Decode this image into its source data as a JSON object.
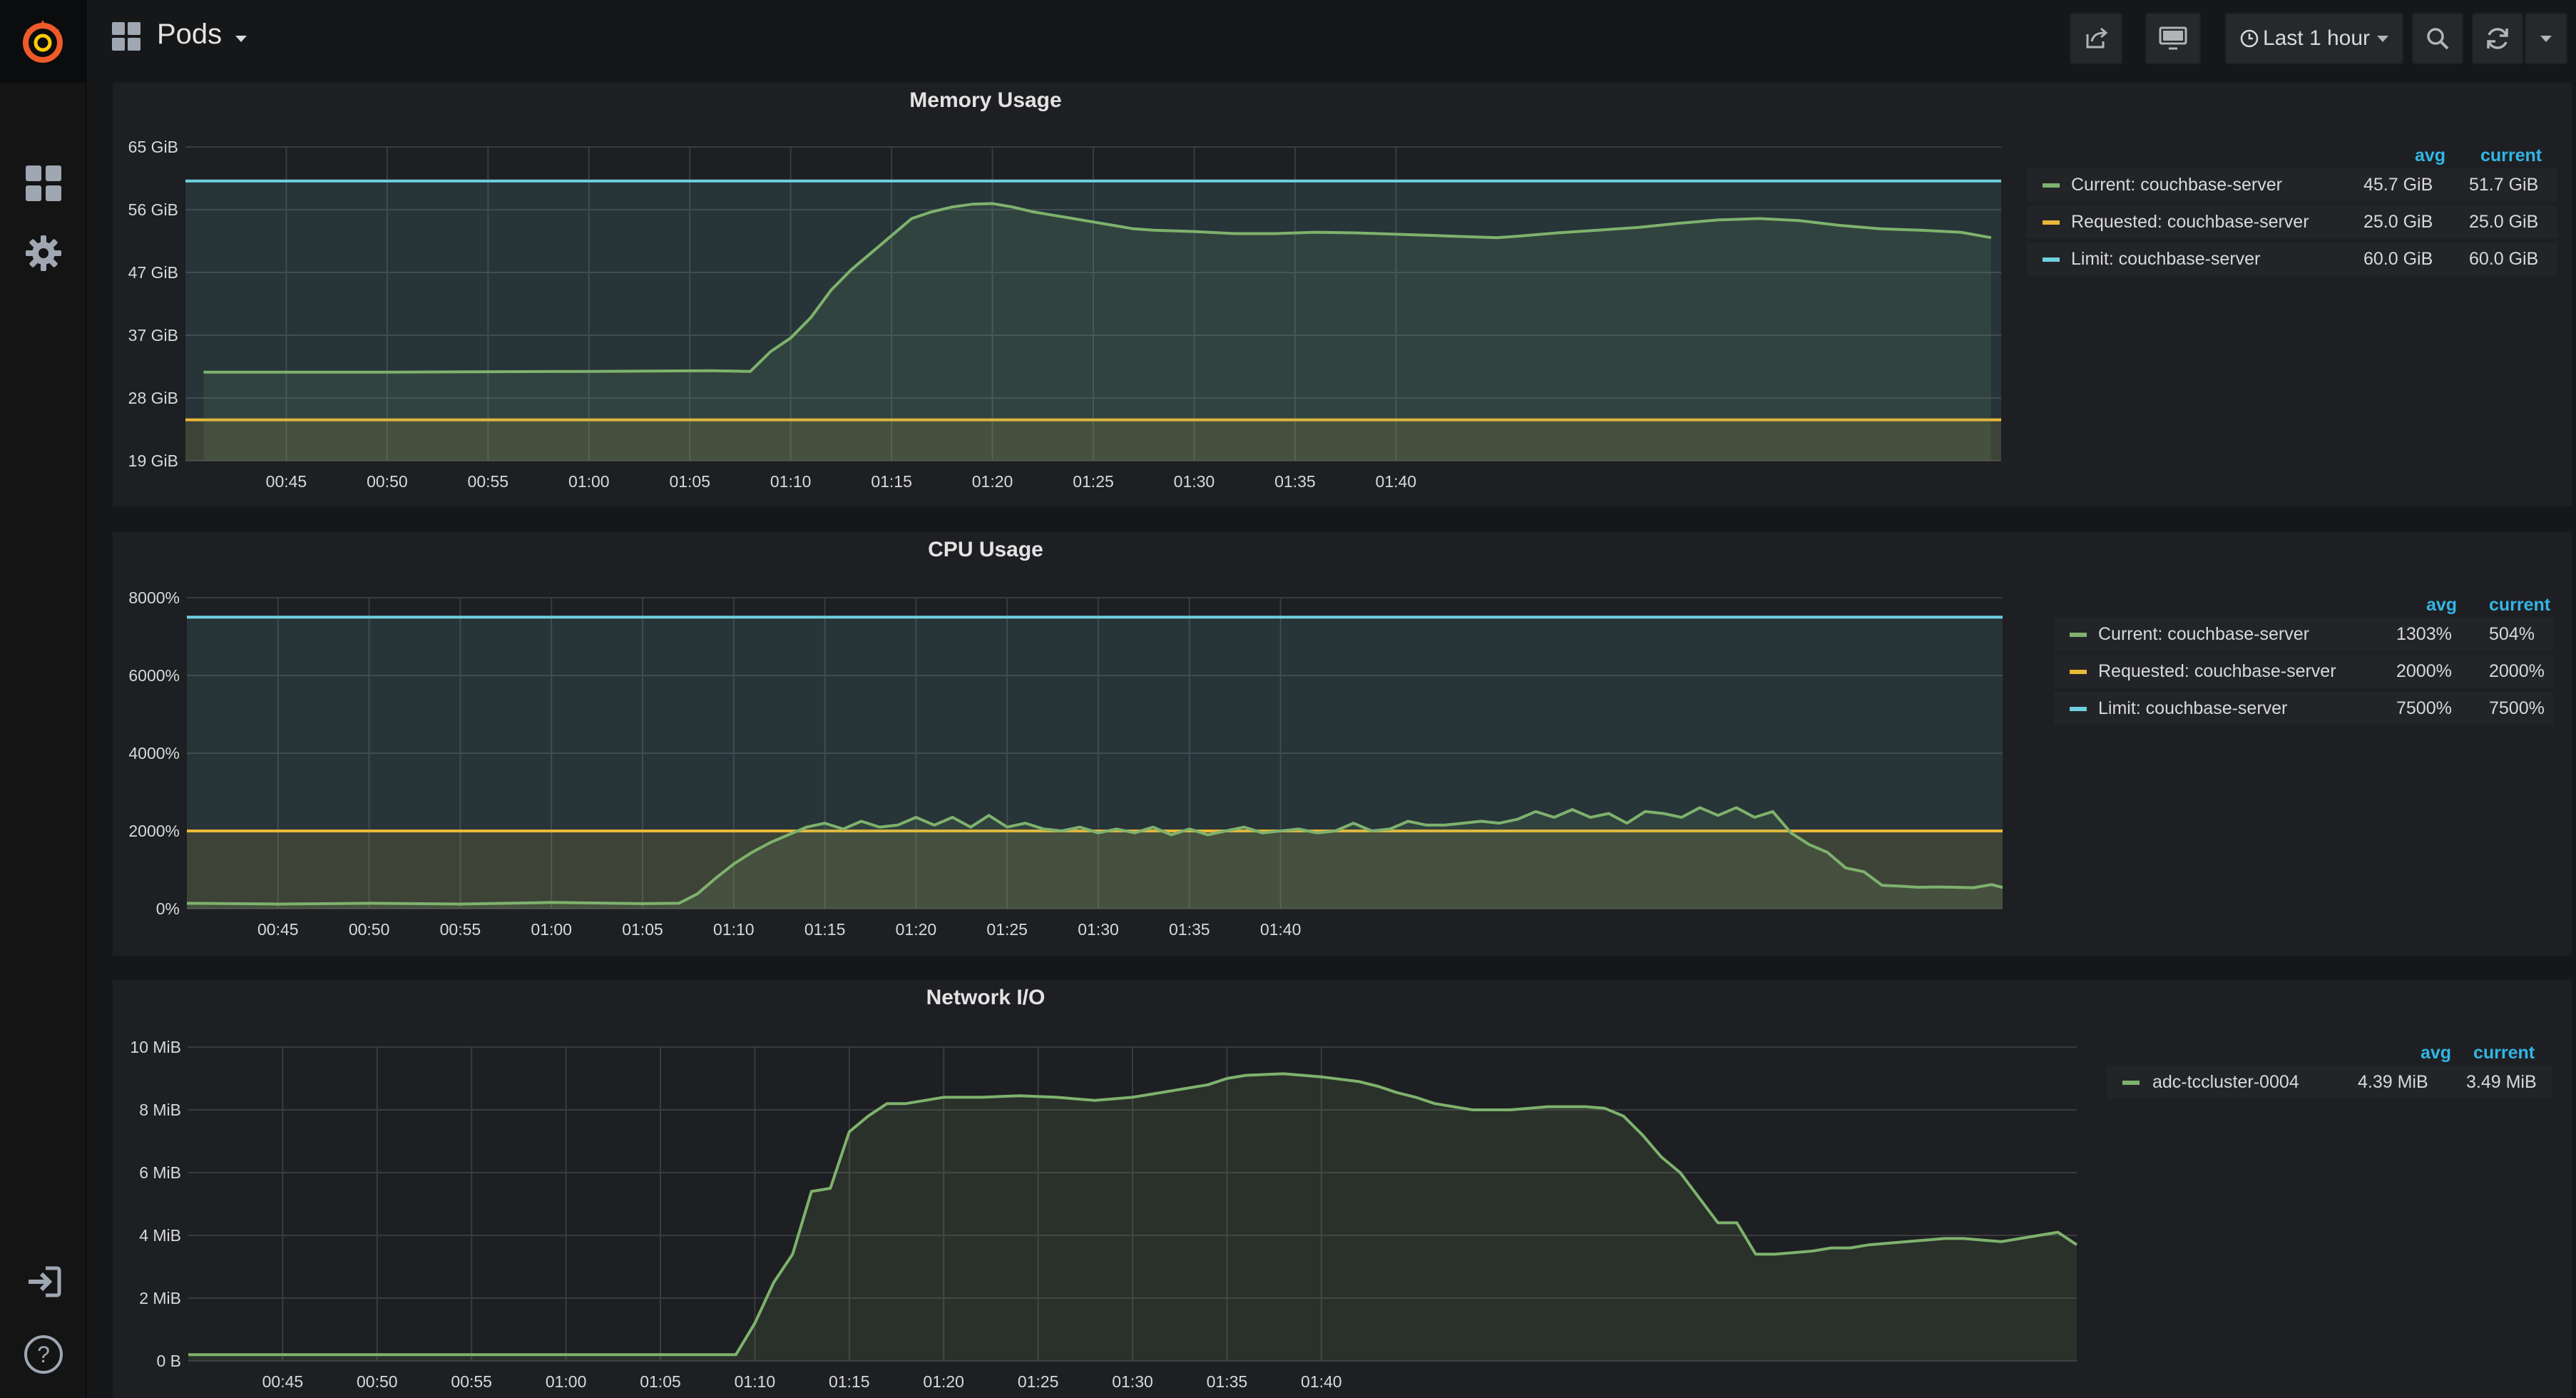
{
  "colors": {
    "current": "#7eb26d",
    "requested": "#eab839",
    "limit": "#6ed0e0",
    "legend_header": "#33b5e5",
    "panel_bg": "#1e1f22"
  },
  "header": {
    "dashboard_title": "Pods",
    "time_range_label": "Last 1 hour",
    "icons": [
      "share-icon",
      "tv-mode-icon",
      "clock-icon",
      "zoom-out-icon",
      "refresh-icon",
      "chevron-down-icon"
    ]
  },
  "sidemenu": {
    "icons": [
      "grafana-logo",
      "dashboards-icon",
      "configuration-icon",
      "sign-in-icon",
      "help-icon"
    ]
  },
  "legend_headers": {
    "avg": "avg",
    "current": "current"
  },
  "panels": {
    "memory": {
      "title": "Memory Usage",
      "legend": [
        {
          "name": "Current: couchbase-server",
          "avg": "45.7 GiB",
          "current": "51.7 GiB",
          "color_key": "current"
        },
        {
          "name": "Requested: couchbase-server",
          "avg": "25.0 GiB",
          "current": "25.0 GiB",
          "color_key": "requested"
        },
        {
          "name": "Limit: couchbase-server",
          "avg": "60.0 GiB",
          "current": "60.0 GiB",
          "color_key": "limit"
        }
      ]
    },
    "cpu": {
      "title": "CPU Usage",
      "legend": [
        {
          "name": "Current: couchbase-server",
          "avg": "1303%",
          "current": "504%",
          "color_key": "current"
        },
        {
          "name": "Requested: couchbase-server",
          "avg": "2000%",
          "current": "2000%",
          "color_key": "requested"
        },
        {
          "name": "Limit: couchbase-server",
          "avg": "7500%",
          "current": "7500%",
          "color_key": "limit"
        }
      ]
    },
    "network": {
      "title": "Network I/O",
      "legend": [
        {
          "name": "adc-tccluster-0004",
          "avg": "4.39 MiB",
          "current": "3.49 MiB",
          "color_key": "current"
        }
      ]
    }
  },
  "chart_data": [
    {
      "type": "area",
      "title": "Memory Usage",
      "x_unit": "minutes from 00:40",
      "x_ticks": [
        "00:45",
        "00:50",
        "00:55",
        "01:00",
        "01:05",
        "01:10",
        "01:15",
        "01:20",
        "01:25",
        "01:30",
        "01:35",
        "01:40"
      ],
      "y_ticks": [
        "19 GiB",
        "28 GiB",
        "37 GiB",
        "47 GiB",
        "56 GiB",
        "65 GiB"
      ],
      "ylim": [
        19,
        65
      ],
      "series": [
        {
          "name": "Current: couchbase-server",
          "color_key": "current",
          "fill": true,
          "points": [
            [
              0.9,
              32.0
            ],
            [
              10,
              32.0
            ],
            [
              20,
              32.1
            ],
            [
              26,
              32.2
            ],
            [
              28,
              32.1
            ],
            [
              29,
              35
            ],
            [
              30,
              37
            ],
            [
              31,
              40
            ],
            [
              32,
              44
            ],
            [
              33,
              47
            ],
            [
              34,
              49.5
            ],
            [
              35,
              52
            ],
            [
              36,
              54.5
            ],
            [
              37,
              55.5
            ],
            [
              38,
              56.2
            ],
            [
              39,
              56.6
            ],
            [
              40,
              56.7
            ],
            [
              41,
              56.2
            ],
            [
              42,
              55.5
            ],
            [
              43,
              55
            ],
            [
              44,
              54.5
            ],
            [
              45,
              54
            ],
            [
              46,
              53.5
            ],
            [
              47,
              53
            ],
            [
              48,
              52.8
            ],
            [
              50,
              52.6
            ],
            [
              52,
              52.3
            ],
            [
              54,
              52.3
            ],
            [
              56,
              52.5
            ],
            [
              58,
              52.4
            ],
            [
              60,
              52.2
            ],
            [
              62,
              52.0
            ],
            [
              64,
              51.8
            ],
            [
              65,
              51.7
            ],
            [
              66,
              51.9
            ],
            [
              68,
              52.4
            ],
            [
              70,
              52.8
            ],
            [
              72,
              53.2
            ],
            [
              74,
              53.8
            ],
            [
              76,
              54.3
            ],
            [
              78,
              54.5
            ],
            [
              80,
              54.2
            ],
            [
              82,
              53.5
            ],
            [
              84,
              53.0
            ],
            [
              86,
              52.8
            ],
            [
              88,
              52.5
            ],
            [
              89.5,
              51.7
            ]
          ]
        },
        {
          "name": "Requested: couchbase-server",
          "color_key": "requested",
          "fill": true,
          "points": [
            [
              0,
              25.0
            ],
            [
              90,
              25.0
            ]
          ]
        },
        {
          "name": "Limit: couchbase-server",
          "color_key": "limit",
          "fill": true,
          "points": [
            [
              0,
              60.0
            ],
            [
              90,
              60.0
            ]
          ]
        }
      ]
    },
    {
      "type": "area",
      "title": "CPU Usage",
      "x_unit": "minutes from 00:40",
      "x_ticks": [
        "00:45",
        "00:50",
        "00:55",
        "01:00",
        "01:05",
        "01:10",
        "01:15",
        "01:20",
        "01:25",
        "01:30",
        "01:35",
        "01:40"
      ],
      "y_ticks": [
        "0%",
        "2000%",
        "4000%",
        "6000%",
        "8000%"
      ],
      "ylim": [
        0,
        8000
      ],
      "series": [
        {
          "name": "Current: couchbase-server",
          "color_key": "current",
          "fill": true,
          "points": [
            [
              0,
              140
            ],
            [
              5,
              120
            ],
            [
              10,
              140
            ],
            [
              15,
              120
            ],
            [
              20,
              160
            ],
            [
              25,
              130
            ],
            [
              27,
              140
            ],
            [
              28,
              380
            ],
            [
              29,
              780
            ],
            [
              30,
              1150
            ],
            [
              31,
              1450
            ],
            [
              32,
              1700
            ],
            [
              33,
              1900
            ],
            [
              34,
              2100
            ],
            [
              35,
              2200
            ],
            [
              36,
              2050
            ],
            [
              37,
              2250
            ],
            [
              38,
              2100
            ],
            [
              39,
              2150
            ],
            [
              40,
              2350
            ],
            [
              41,
              2150
            ],
            [
              42,
              2350
            ],
            [
              43,
              2100
            ],
            [
              44,
              2400
            ],
            [
              45,
              2100
            ],
            [
              46,
              2200
            ],
            [
              47,
              2050
            ],
            [
              48,
              2000
            ],
            [
              49,
              2100
            ],
            [
              50,
              1950
            ],
            [
              51,
              2050
            ],
            [
              52,
              1950
            ],
            [
              53,
              2100
            ],
            [
              54,
              1900
            ],
            [
              55,
              2050
            ],
            [
              56,
              1900
            ],
            [
              57,
              2000
            ],
            [
              58,
              2100
            ],
            [
              59,
              1950
            ],
            [
              60,
              2000
            ],
            [
              61,
              2050
            ],
            [
              62,
              1950
            ],
            [
              63,
              2000
            ],
            [
              64,
              2200
            ],
            [
              65,
              2000
            ],
            [
              66,
              2050
            ],
            [
              67,
              2250
            ],
            [
              68,
              2150
            ],
            [
              69,
              2150
            ],
            [
              70,
              2200
            ],
            [
              71,
              2250
            ],
            [
              72,
              2200
            ],
            [
              73,
              2300
            ],
            [
              74,
              2500
            ],
            [
              75,
              2350
            ],
            [
              76,
              2550
            ],
            [
              77,
              2350
            ],
            [
              78,
              2450
            ],
            [
              79,
              2200
            ],
            [
              80,
              2500
            ],
            [
              81,
              2450
            ],
            [
              82,
              2350
            ],
            [
              83,
              2600
            ],
            [
              84,
              2400
            ],
            [
              85,
              2600
            ],
            [
              86,
              2350
            ],
            [
              87,
              2500
            ],
            [
              88,
              1950
            ],
            [
              89,
              1650
            ],
            [
              90,
              1450
            ],
            [
              91,
              1050
            ],
            [
              92,
              950
            ],
            [
              93,
              600
            ],
            [
              94,
              580
            ],
            [
              95,
              550
            ],
            [
              96,
              560
            ],
            [
              97,
              550
            ],
            [
              98,
              540
            ],
            [
              99,
              620
            ],
            [
              100,
              500
            ]
          ]
        },
        {
          "name": "Requested: couchbase-server",
          "color_key": "requested",
          "fill": true,
          "points": [
            [
              0,
              2000
            ],
            [
              100,
              2000
            ]
          ]
        },
        {
          "name": "Limit: couchbase-server",
          "color_key": "limit",
          "fill": true,
          "points": [
            [
              0,
              7500
            ],
            [
              100,
              7500
            ]
          ]
        }
      ]
    },
    {
      "type": "area",
      "title": "Network I/O",
      "series_name": "adc-tccluster-0004",
      "x_unit": "minutes from 00:40",
      "x_ticks": [
        "00:45",
        "00:50",
        "00:55",
        "01:00",
        "01:05",
        "01:10",
        "01:15",
        "01:20",
        "01:25",
        "01:30",
        "01:35",
        "01:40"
      ],
      "y_ticks": [
        "0 B",
        "2 MiB",
        "4 MiB",
        "6 MiB",
        "8 MiB",
        "10 MiB"
      ],
      "ylim": [
        0,
        10
      ],
      "series": [
        {
          "name": "adc-tccluster-0004",
          "color_key": "current",
          "fill": true,
          "points": [
            [
              0,
              0.2
            ],
            [
              10,
              0.2
            ],
            [
              20,
              0.2
            ],
            [
              29,
              0.2
            ],
            [
              30,
              1.2
            ],
            [
              31,
              2.5
            ],
            [
              32,
              3.4
            ],
            [
              33,
              5.4
            ],
            [
              34,
              5.5
            ],
            [
              35,
              7.3
            ],
            [
              36,
              7.8
            ],
            [
              37,
              8.2
            ],
            [
              38,
              8.2
            ],
            [
              39,
              8.3
            ],
            [
              40,
              8.4
            ],
            [
              42,
              8.4
            ],
            [
              44,
              8.45
            ],
            [
              46,
              8.4
            ],
            [
              48,
              8.3
            ],
            [
              50,
              8.4
            ],
            [
              52,
              8.6
            ],
            [
              54,
              8.8
            ],
            [
              55,
              9.0
            ],
            [
              56,
              9.1
            ],
            [
              58,
              9.15
            ],
            [
              60,
              9.05
            ],
            [
              62,
              8.9
            ],
            [
              63,
              8.75
            ],
            [
              64,
              8.55
            ],
            [
              65,
              8.4
            ],
            [
              66,
              8.2
            ],
            [
              67,
              8.1
            ],
            [
              68,
              8.0
            ],
            [
              70,
              8.0
            ],
            [
              72,
              8.1
            ],
            [
              74,
              8.1
            ],
            [
              75,
              8.05
            ],
            [
              76,
              7.8
            ],
            [
              77,
              7.2
            ],
            [
              78,
              6.5
            ],
            [
              79,
              6.0
            ],
            [
              80,
              5.2
            ],
            [
              81,
              4.4
            ],
            [
              82,
              4.4
            ],
            [
              83,
              3.4
            ],
            [
              84,
              3.4
            ],
            [
              85,
              3.45
            ],
            [
              86,
              3.5
            ],
            [
              87,
              3.6
            ],
            [
              88,
              3.6
            ],
            [
              89,
              3.7
            ],
            [
              90,
              3.75
            ],
            [
              91,
              3.8
            ],
            [
              92,
              3.85
            ],
            [
              93,
              3.9
            ],
            [
              94,
              3.9
            ],
            [
              95,
              3.85
            ],
            [
              96,
              3.8
            ],
            [
              97,
              3.9
            ],
            [
              98,
              4.0
            ],
            [
              99,
              4.1
            ],
            [
              100,
              3.7
            ]
          ]
        }
      ]
    }
  ]
}
